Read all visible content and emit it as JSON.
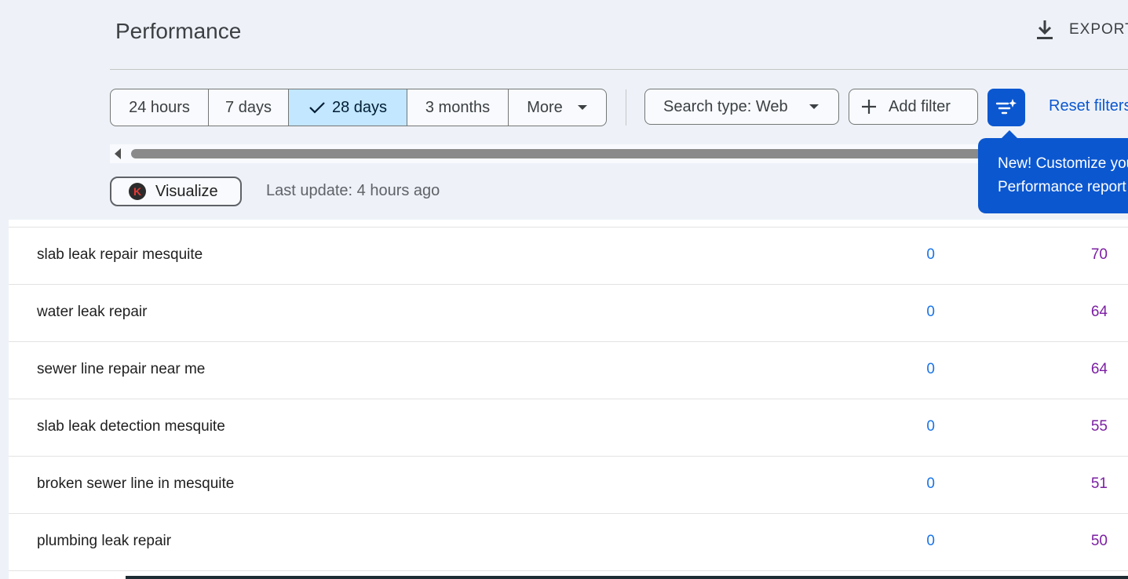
{
  "header": {
    "title": "Performance",
    "export_label": "EXPORT"
  },
  "date_range": {
    "options": [
      "24 hours",
      "7 days",
      "28 days",
      "3 months",
      "More"
    ],
    "selected": "28 days"
  },
  "filters": {
    "search_type_label": "Search type: Web",
    "add_filter_label": "Add filter",
    "reset_label": "Reset filters"
  },
  "tooltip": {
    "line1": "New! Customize your",
    "line2": "Performance report"
  },
  "toolbar": {
    "visualize_label": "Visualize",
    "last_update": "Last update: 4 hours ago"
  },
  "rows": [
    {
      "query": "slab leak repair mesquite",
      "clicks": "0",
      "impressions": "70"
    },
    {
      "query": "water leak repair",
      "clicks": "0",
      "impressions": "64"
    },
    {
      "query": "sewer line repair near me",
      "clicks": "0",
      "impressions": "64"
    },
    {
      "query": "slab leak detection mesquite",
      "clicks": "0",
      "impressions": "55"
    },
    {
      "query": "broken sewer line in mesquite",
      "clicks": "0",
      "impressions": "51"
    },
    {
      "query": "plumbing leak repair",
      "clicks": "0",
      "impressions": "50"
    }
  ],
  "colors": {
    "accent": "#0b57d0",
    "selected_chip": "#c2e7ff",
    "clicks": "#1a73e8",
    "impressions": "#7b1fa2"
  }
}
